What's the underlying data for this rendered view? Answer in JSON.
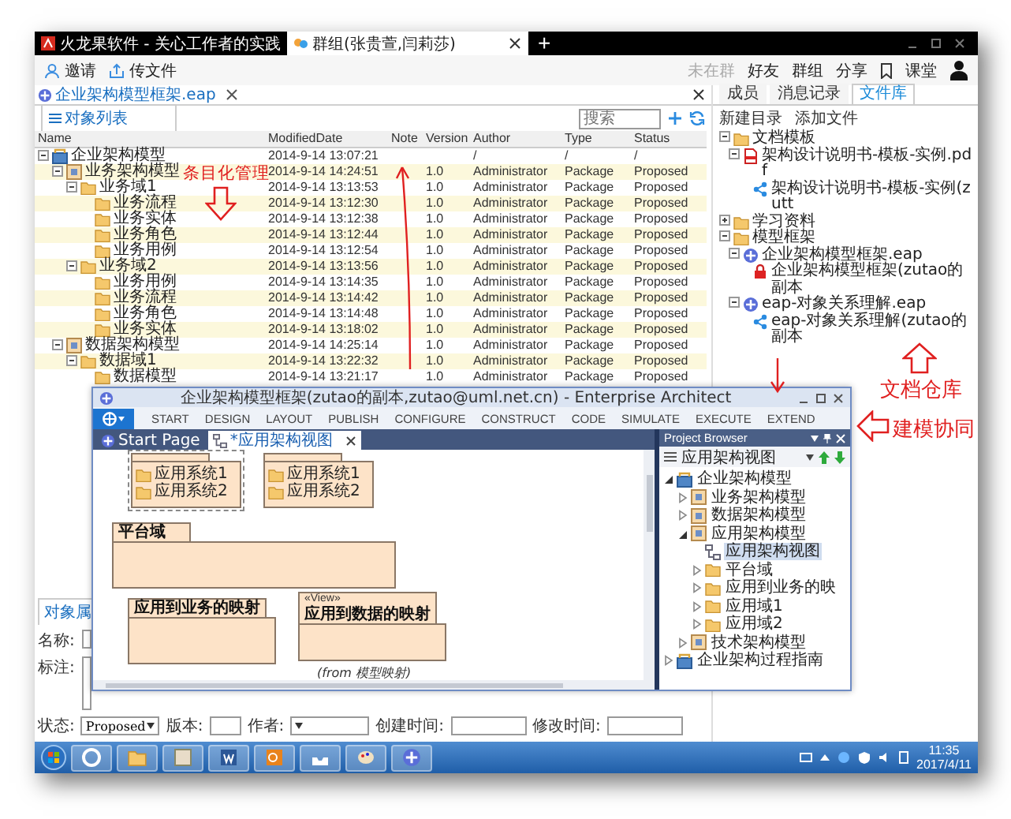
{
  "chat_tabs": [
    {
      "label": "火龙果软件 - 关心工作者的实践",
      "selected": false
    },
    {
      "label": "群组(张贵萱,闫莉莎)",
      "selected": true
    }
  ],
  "new_tab": "+",
  "toolbar": {
    "left": [
      {
        "label": "邀请",
        "kind": "invite"
      },
      {
        "label": "传文件",
        "kind": "file"
      }
    ],
    "right": [
      {
        "label": "未在群",
        "disabled": true,
        "kind": "text"
      },
      {
        "label": "好友",
        "disabled": false,
        "kind": "text"
      },
      {
        "label": "群组",
        "disabled": false,
        "kind": "text"
      },
      {
        "label": "分享",
        "disabled": false,
        "kind": "text"
      },
      {
        "label": "课堂",
        "disabled": false,
        "kind": "bookmark"
      }
    ]
  },
  "document_tab": {
    "label": "企业架构模型框架.eap"
  },
  "object_list": {
    "tab": "对象列表",
    "search": {
      "placeholder": "搜索"
    },
    "columns": [
      "Name",
      "ModifiedDate",
      "Note",
      "Version",
      "Author",
      "Type",
      "Status"
    ],
    "rows": [
      {
        "name": "企业架构模型",
        "kind": "model",
        "expanded": true,
        "modified": "2014-9-14 13:07:21",
        "author": "/",
        "type": "/",
        "status": "/",
        "children": [
          {
            "name": "业务架构模型",
            "kind": "package",
            "expanded": true,
            "modified": "2014-9-14 14:24:51",
            "version": "1.0",
            "author": "Administrator",
            "type": "Package",
            "status": "Proposed",
            "children": [
              {
                "name": "业务域1",
                "kind": "folder",
                "expanded": true,
                "modified": "2014-9-14 13:13:53",
                "version": "1.0",
                "author": "Administrator",
                "type": "Package",
                "status": "Proposed",
                "children": [
                  {
                    "name": "业务流程",
                    "kind": "folder",
                    "modified": "2014-9-14 13:12:30",
                    "version": "1.0",
                    "author": "Administrator",
                    "type": "Package",
                    "status": "Proposed"
                  },
                  {
                    "name": "业务实体",
                    "kind": "folder",
                    "modified": "2014-9-14 13:12:38",
                    "version": "1.0",
                    "author": "Administrator",
                    "type": "Package",
                    "status": "Proposed"
                  },
                  {
                    "name": "业务角色",
                    "kind": "folder",
                    "modified": "2014-9-14 13:12:44",
                    "version": "1.0",
                    "author": "Administrator",
                    "type": "Package",
                    "status": "Proposed"
                  },
                  {
                    "name": "业务用例",
                    "kind": "folder",
                    "modified": "2014-9-14 13:12:54",
                    "version": "1.0",
                    "author": "Administrator",
                    "type": "Package",
                    "status": "Proposed"
                  }
                ]
              },
              {
                "name": "业务域2",
                "kind": "folder",
                "expanded": true,
                "modified": "2014-9-14 13:13:56",
                "version": "1.0",
                "author": "Administrator",
                "type": "Package",
                "status": "Proposed",
                "children": [
                  {
                    "name": "业务用例",
                    "kind": "folder",
                    "modified": "2014-9-14 13:14:35",
                    "version": "1.0",
                    "author": "Administrator",
                    "type": "Package",
                    "status": "Proposed"
                  },
                  {
                    "name": "业务流程",
                    "kind": "folder",
                    "modified": "2014-9-14 13:14:42",
                    "version": "1.0",
                    "author": "Administrator",
                    "type": "Package",
                    "status": "Proposed"
                  },
                  {
                    "name": "业务角色",
                    "kind": "folder",
                    "modified": "2014-9-14 13:14:48",
                    "version": "1.0",
                    "author": "Administrator",
                    "type": "Package",
                    "status": "Proposed"
                  },
                  {
                    "name": "业务实体",
                    "kind": "folder",
                    "modified": "2014-9-14 13:18:02",
                    "version": "1.0",
                    "author": "Administrator",
                    "type": "Package",
                    "status": "Proposed"
                  }
                ]
              }
            ]
          },
          {
            "name": "数据架构模型",
            "kind": "package",
            "expanded": true,
            "modified": "2014-9-14 14:25:14",
            "version": "1.0",
            "author": "Administrator",
            "type": "Package",
            "status": "Proposed",
            "children": [
              {
                "name": "数据域1",
                "kind": "folder",
                "expanded": true,
                "modified": "2014-9-14 13:22:32",
                "version": "1.0",
                "author": "Administrator",
                "type": "Package",
                "status": "Proposed",
                "children": [
                  {
                    "name": "数据模型",
                    "kind": "folder",
                    "modified": "2014-9-14 13:21:17",
                    "version": "1.0",
                    "author": "Administrator",
                    "type": "Package",
                    "status": "Proposed"
                  }
                ]
              }
            ]
          }
        ]
      }
    ]
  },
  "properties": {
    "tab": "对象属",
    "name_label": "名称:",
    "note_label": "标注:",
    "fields": [
      {
        "label": "状态:",
        "kind": "select",
        "value": "Proposed"
      },
      {
        "label": "版本:",
        "kind": "text"
      },
      {
        "label": "作者:",
        "kind": "select"
      },
      {
        "label": "创建时间:",
        "kind": "text"
      },
      {
        "label": "修改时间:",
        "kind": "text"
      }
    ]
  },
  "side_panel": {
    "tabs": [
      {
        "label": "成员",
        "selected": false
      },
      {
        "label": "消息记录",
        "selected": false
      },
      {
        "label": "文件库",
        "selected": true
      }
    ],
    "actions": [
      "新建目录",
      "添加文件"
    ],
    "tree": [
      {
        "label": "文档模板",
        "kind": "folder",
        "expanded": true,
        "children": [
          {
            "label": "架构设计说明书-模板-实例.pdf",
            "kind": "pdf",
            "expanded": true,
            "children": [
              {
                "label": "架构设计说明书-模板-实例(zutt",
                "kind": "share"
              }
            ]
          }
        ]
      },
      {
        "label": "学习资料",
        "kind": "folder",
        "expanded": false
      },
      {
        "label": "模型框架",
        "kind": "folder",
        "expanded": true,
        "children": [
          {
            "label": "企业架构模型框架.eap",
            "kind": "eap",
            "expanded": true,
            "children": [
              {
                "label": "企业架构模型框架(zutao的副本",
                "kind": "lock"
              }
            ]
          },
          {
            "label": "eap-对象关系理解.eap",
            "kind": "eap",
            "expanded": true,
            "children": [
              {
                "label": "eap-对象关系理解(zutao的副本",
                "kind": "share"
              }
            ]
          }
        ]
      }
    ]
  },
  "ea_window": {
    "title": "企业架构模型框架(zutao的副本,zutao@uml.net.cn) - Enterprise Architect",
    "ribbon": [
      "START",
      "DESIGN",
      "LAYOUT",
      "PUBLISH",
      "CONFIGURE",
      "CONSTRUCT",
      "CODE",
      "SIMULATE",
      "EXECUTE",
      "EXTEND"
    ],
    "doc_tabs": [
      {
        "label": "Start Page",
        "selected": false
      },
      {
        "label": "*应用架构视图",
        "selected": true
      }
    ],
    "packages": [
      {
        "items": [
          "应用系统1",
          "应用系统2"
        ],
        "selected": true
      },
      {
        "items": [
          "应用系统1",
          "应用系统2"
        ],
        "selected": false
      },
      {
        "name": "平台域",
        "selected": false
      },
      {
        "name": "应用到业务的映射",
        "selected": false
      },
      {
        "stereotype": "«View»",
        "name": "应用到数据的映射",
        "from": "(from 模型映射)",
        "selected": false
      }
    ],
    "browser": {
      "title": "Project Browser",
      "view": "应用架构视图",
      "tree": [
        {
          "label": "企业架构模型",
          "kind": "model",
          "expanded": true,
          "selected": false,
          "children": [
            {
              "label": "业务架构模型",
              "kind": "package",
              "expanded": false,
              "selected": false
            },
            {
              "label": "数据架构模型",
              "kind": "package",
              "expanded": false,
              "selected": false
            },
            {
              "label": "应用架构模型",
              "kind": "package",
              "expanded": true,
              "selected": false,
              "children": [
                {
                  "label": "应用架构视图",
                  "kind": "diagram",
                  "selected": true
                },
                {
                  "label": "平台域",
                  "kind": "folder",
                  "expanded": false,
                  "selected": false
                },
                {
                  "label": "应用到业务的映",
                  "kind": "folder",
                  "expanded": false,
                  "selected": false
                },
                {
                  "label": "应用域1",
                  "kind": "folder",
                  "expanded": false,
                  "selected": false
                },
                {
                  "label": "应用域2",
                  "kind": "folder",
                  "expanded": false,
                  "selected": false
                }
              ]
            },
            {
              "label": "技术架构模型",
              "kind": "package",
              "expanded": false,
              "selected": false
            }
          ]
        },
        {
          "label": "企业架构过程指南",
          "kind": "model",
          "expanded": false,
          "selected": false
        }
      ]
    }
  },
  "annotations": [
    {
      "text": "条目化管理"
    },
    {
      "text": "文档仓库"
    },
    {
      "text": "建模协同"
    }
  ],
  "clock": {
    "time": "11:35",
    "date": "2017/4/11"
  }
}
